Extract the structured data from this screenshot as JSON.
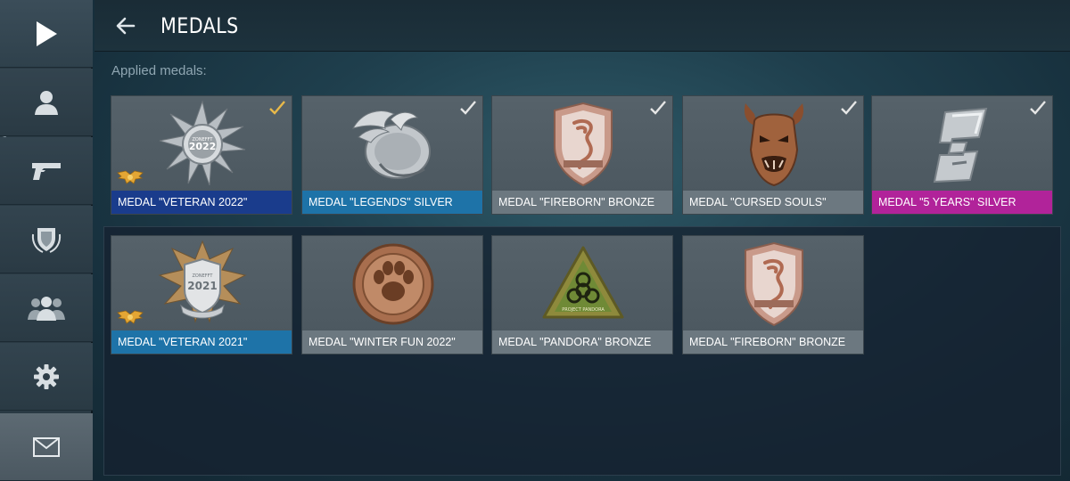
{
  "header": {
    "title": "MEDALS"
  },
  "section": {
    "applied_label": "Applied medals:"
  },
  "sidebar": {
    "items": [
      {
        "name": "play-icon"
      },
      {
        "name": "profile-icon"
      },
      {
        "name": "pistol-icon"
      },
      {
        "name": "shield-icon"
      },
      {
        "name": "team-icon"
      },
      {
        "name": "gear-icon"
      },
      {
        "name": "mail-icon"
      }
    ]
  },
  "medals": [
    {
      "label": "MEDAL \"VETERAN 2022\"",
      "color": "#1a3c8c",
      "checked": true,
      "check_color": "#e8b94a",
      "wings": true,
      "icon": "veteran-2022-medal-icon"
    },
    {
      "label": "MEDAL \"LEGENDS\" SILVER",
      "color": "#1e73a8",
      "checked": true,
      "check_color": "#e6e6e6",
      "wings": false,
      "icon": "legends-medal-icon"
    },
    {
      "label": "MEDAL \"FIREBORN\" BRONZE",
      "color": "#6c7880",
      "checked": true,
      "check_color": "#e6e6e6",
      "wings": false,
      "icon": "fireborn-medal-icon"
    },
    {
      "label": "MEDAL \"CURSED SOULS\"",
      "color": "#6c7880",
      "checked": true,
      "check_color": "#e6e6e6",
      "wings": false,
      "icon": "cursed-souls-medal-icon"
    },
    {
      "label": "MEDAL \"5 YEARS\" SILVER",
      "color": "#b1239a",
      "checked": true,
      "check_color": "#e6e6e6",
      "wings": false,
      "icon": "five-years-medal-icon"
    },
    {
      "label": "MEDAL \"VETERAN 2021\"",
      "color": "#1e73a8",
      "checked": false,
      "wings": true,
      "icon": "veteran-2021-medal-icon"
    },
    {
      "label": "MEDAL \"WINTER FUN 2022\"",
      "color": "#6c7880",
      "checked": false,
      "wings": false,
      "icon": "winter-fun-medal-icon"
    },
    {
      "label": "MEDAL \"PANDORA\" BRONZE",
      "color": "#6c7880",
      "checked": false,
      "wings": false,
      "icon": "pandora-medal-icon"
    },
    {
      "label": "MEDAL \"FIREBORN\" BRONZE",
      "color": "#6c7880",
      "checked": false,
      "wings": false,
      "icon": "fireborn-medal-icon"
    }
  ],
  "medal_text": {
    "veteran_2022": {
      "top": "ZONEFFT",
      "year": "2022"
    },
    "veteran_2021": {
      "top": "ZONEFFT",
      "year": "2021"
    },
    "pandora": "PROJECT PANDORA"
  }
}
